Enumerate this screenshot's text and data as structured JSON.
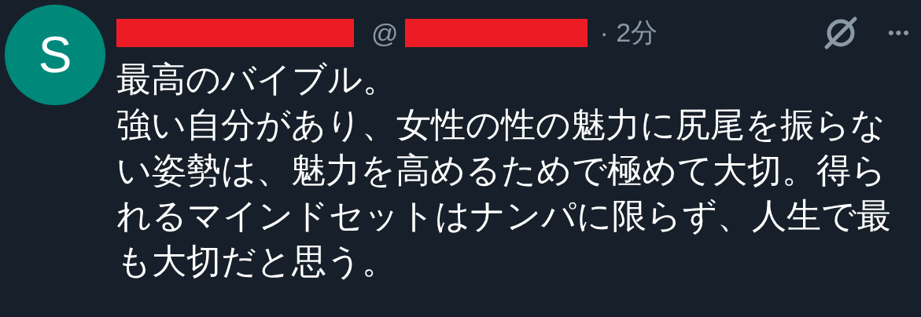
{
  "post": {
    "avatar_letter": "S",
    "handle_prefix": "@",
    "time": "· 2分",
    "more": "•••",
    "body": [
      "最高のバイブル。",
      "強い自分があり、女性の性の魅力に尻尾を振らない姿勢は、魅力を高めるためで極めて大切。得られるマインドセットはナンパに限らず、人生で最も大切だと思う。"
    ]
  }
}
